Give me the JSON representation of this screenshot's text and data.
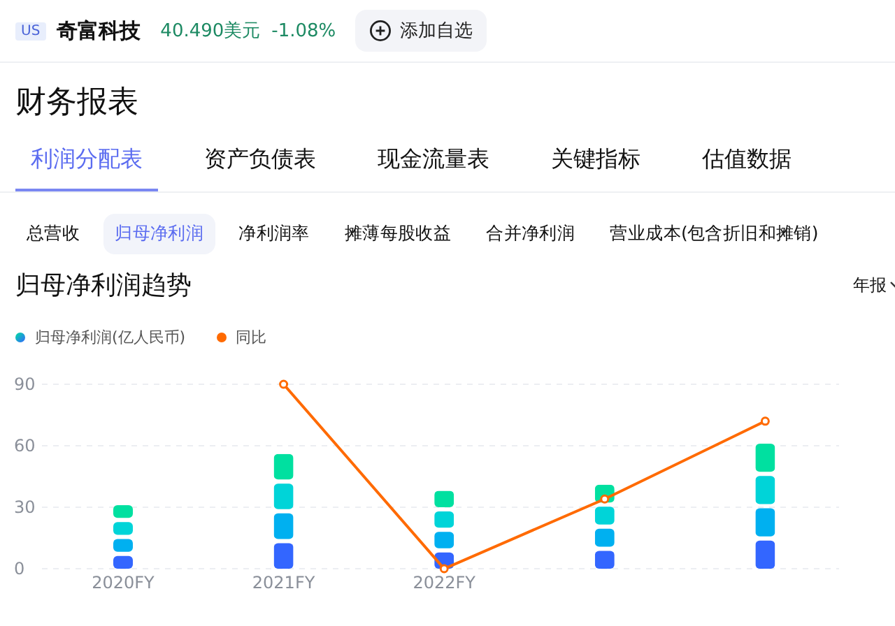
{
  "header": {
    "market": "US",
    "name": "奇富科技",
    "price": "40.490美元",
    "change": "-1.08%",
    "watch_button": "添加自选"
  },
  "page_title": "财务报表",
  "tabs": [
    {
      "label": "利润分配表",
      "selected": true
    },
    {
      "label": "资产负债表",
      "selected": false
    },
    {
      "label": "现金流量表",
      "selected": false
    },
    {
      "label": "关键指标",
      "selected": false
    },
    {
      "label": "估值数据",
      "selected": false
    }
  ],
  "sub_tabs": [
    {
      "label": "总营收",
      "selected": false
    },
    {
      "label": "归母净利润",
      "selected": true
    },
    {
      "label": "净利润率",
      "selected": false
    },
    {
      "label": "摊薄每股收益",
      "selected": false
    },
    {
      "label": "合并净利润",
      "selected": false
    },
    {
      "label": "营业成本(包含折旧和摊销)",
      "selected": false
    }
  ],
  "section_title": "归母净利润趋势",
  "period_selector": "年报",
  "chart_data": {
    "type": "bar",
    "categories": [
      "2020FY",
      "2021FY",
      "2022FY",
      null,
      null
    ],
    "yticks": [
      0,
      30,
      60,
      90
    ],
    "ylim": [
      0,
      90
    ],
    "series": [
      {
        "name": "归母净利润(亿人民币)",
        "values": [
          31,
          56,
          38,
          41,
          61
        ]
      },
      {
        "name": "同比",
        "type": "line",
        "marker": true,
        "color": "#ff6a00",
        "values": [
          null,
          90,
          0,
          34,
          72
        ]
      }
    ]
  }
}
